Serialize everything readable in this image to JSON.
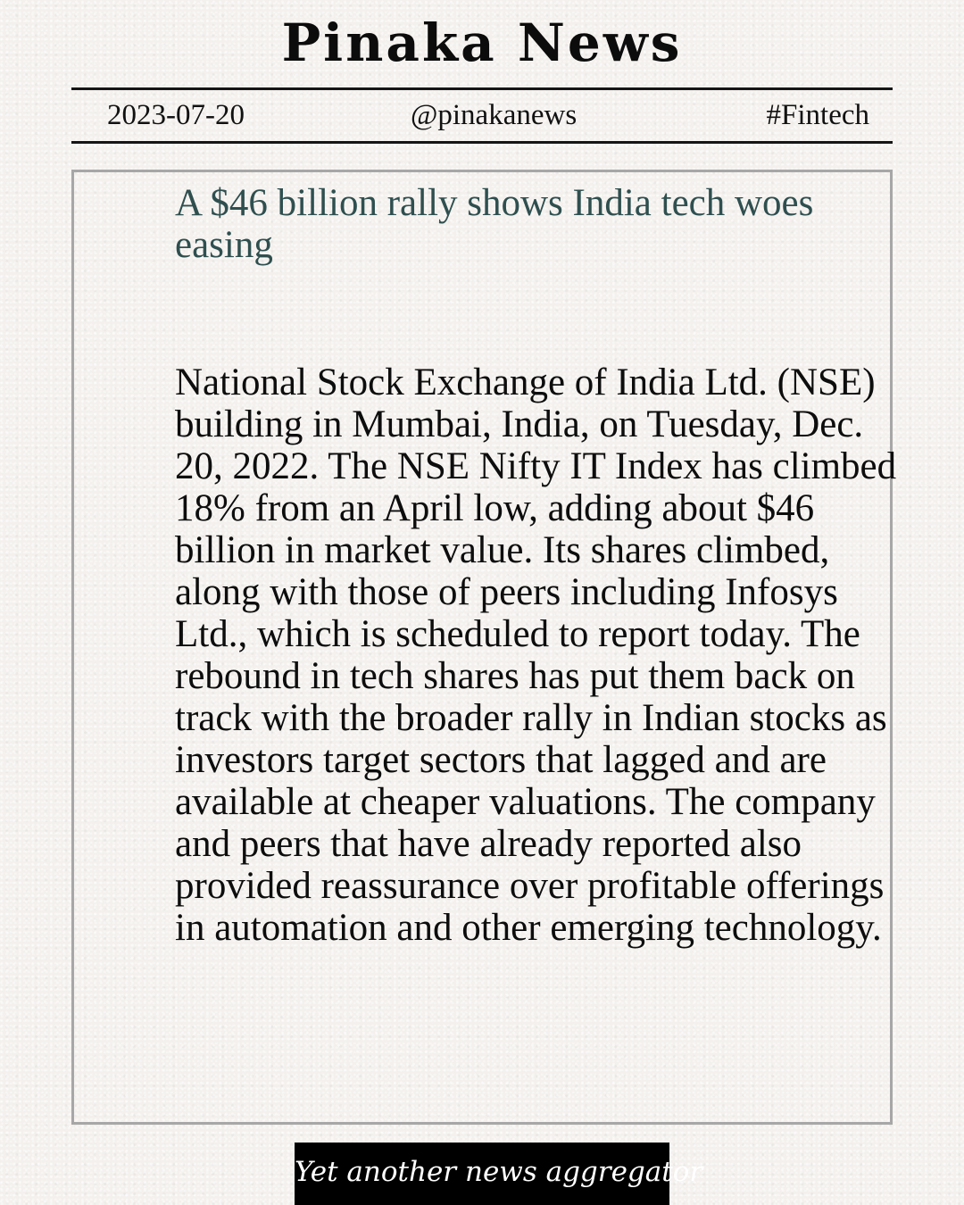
{
  "masthead": {
    "title": "Pinaka News"
  },
  "meta": {
    "date": "2023-07-20",
    "handle": "@pinakanews",
    "tag": "#Fintech"
  },
  "article": {
    "headline": "A $46 billion rally shows India tech woes easing",
    "body": "National Stock Exchange of India Ltd. (NSE) building in Mumbai, India, on Tuesday, Dec. 20, 2022. The NSE Nifty IT Index has climbed 18% from an April low, adding about $46 billion in market value. Its shares climbed, along with those of peers including Infosys Ltd., which is scheduled to report today. The rebound in tech shares has put them back on track with the broader rally in Indian stocks as investors target sectors that lagged and are available at cheaper valuations. The company and peers that have already reported also provided reassurance over profitable offerings in automation and other emerging technology."
  },
  "footer": {
    "tagline": "Yet another news aggregator"
  }
}
